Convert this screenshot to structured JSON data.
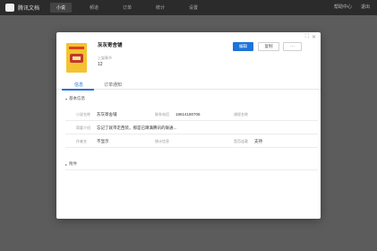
{
  "app": {
    "brand": "腾讯文档",
    "nav": [
      "小说",
      "频道",
      "订单",
      "统计",
      "设置"
    ],
    "active_nav_index": 0,
    "top_right": [
      "帮助中心",
      "退出"
    ]
  },
  "window_controls": [
    "⛶",
    "✕"
  ],
  "book": {
    "title": "灰灰寄舍铺",
    "meta_label": "上架章节",
    "meta_value": "12"
  },
  "actions": {
    "primary": "编辑",
    "secondary": "复制",
    "more": "···"
  },
  "tabs": [
    "信息",
    "订单通知"
  ],
  "active_tab_index": 0,
  "sections": {
    "basic": "基本信息",
    "attachments": "附件"
  },
  "fields": {
    "row1": [
      {
        "label": "小说名称",
        "value": "灰灰寄舍铺"
      },
      {
        "label": "联系电话",
        "value": "18614180706"
      },
      {
        "label": "课程名称",
        "value": ""
      }
    ],
    "row2": [
      {
        "label": "简要介绍",
        "value": "忘记了就带走西装，那是已蹲满腾讯的联通..."
      }
    ],
    "row3": [
      {
        "label": "作者名",
        "value": "不显示"
      },
      {
        "label": "统计信息",
        "value": ""
      },
      {
        "label": "是否连载",
        "value": "支持"
      }
    ]
  },
  "colors": {
    "accent": "#1e74d8",
    "topbar": "#2b2b2b",
    "backdrop": "#5c5c5c"
  }
}
